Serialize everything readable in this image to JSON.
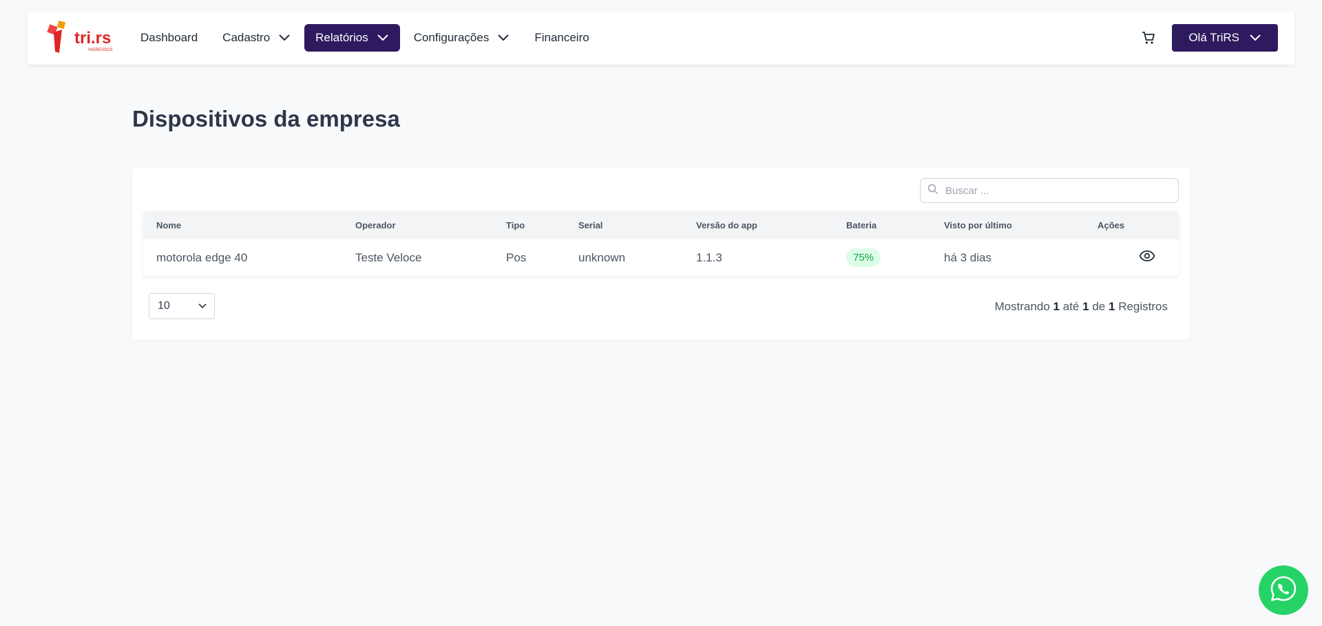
{
  "nav": {
    "logo_text": "tri.rs",
    "logo_subtext": "INGRESSOS",
    "items": [
      {
        "label": "Dashboard",
        "has_dropdown": false,
        "active": false
      },
      {
        "label": "Cadastro",
        "has_dropdown": true,
        "active": false
      },
      {
        "label": "Relatórios",
        "has_dropdown": true,
        "active": true
      },
      {
        "label": "Configurações",
        "has_dropdown": true,
        "active": false
      },
      {
        "label": "Financeiro",
        "has_dropdown": false,
        "active": false
      }
    ],
    "user_label": "Olá TriRS",
    "cart_icon": "cart-icon"
  },
  "page": {
    "title": "Dispositivos da empresa"
  },
  "search": {
    "placeholder": "Buscar ..."
  },
  "table": {
    "headers": [
      "Nome",
      "Operador",
      "Tipo",
      "Serial",
      "Versão do app",
      "Bateria",
      "Visto por último",
      "Ações"
    ],
    "rows": [
      {
        "nome": "motorola edge 40",
        "operador": "Teste Veloce",
        "tipo": "Pos",
        "serial": "unknown",
        "versao": "1.1.3",
        "bateria": "75%",
        "visto": "há 3 dias"
      }
    ]
  },
  "pagination": {
    "page_size": "10",
    "prefix": "Mostrando",
    "from": "1",
    "to_word": "até",
    "to": "1",
    "of_word": "de",
    "total": "1",
    "suffix": "Registros"
  },
  "colors": {
    "primary": "#2e1a5e",
    "success_bg": "#dcfce7",
    "success_text": "#16a34a",
    "whatsapp": "#25d366"
  }
}
